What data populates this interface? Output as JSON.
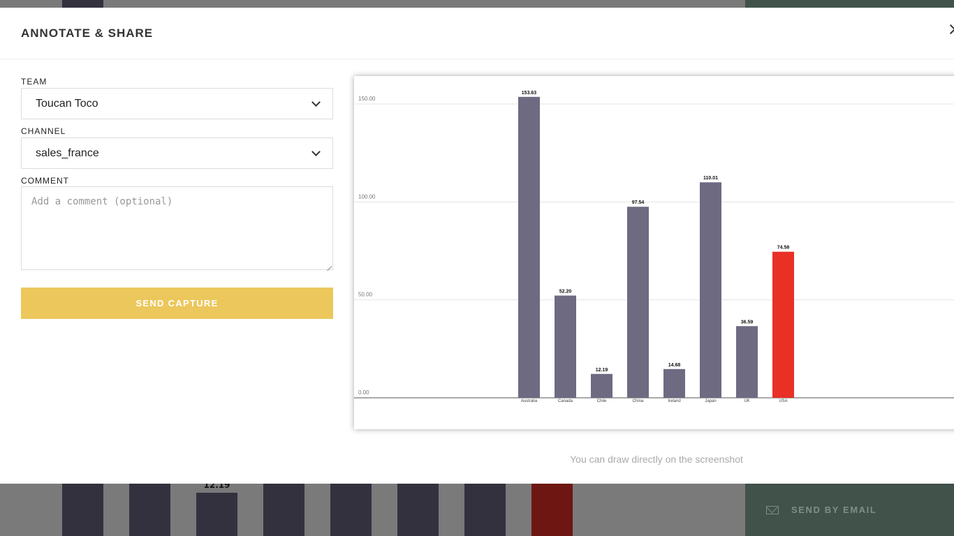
{
  "modal": {
    "title": "ANNOTATE & SHARE",
    "team": {
      "label": "TEAM",
      "value": "Toucan Toco"
    },
    "channel": {
      "label": "CHANNEL",
      "value": "sales_france"
    },
    "comment": {
      "label": "COMMENT",
      "placeholder": "Add a comment (optional)"
    },
    "send_button": "SEND CAPTURE",
    "hint": "You can draw directly on the screenshot"
  },
  "background": {
    "bar_value_label": "12.19",
    "send_email_label": "SEND BY EMAIL"
  },
  "colors": {
    "bar": "#6e6a82",
    "highlight_bar": "#e83025",
    "send_button": "#ecc75c",
    "email_panel": "#41524a"
  },
  "chart_data": {
    "type": "bar",
    "categories": [
      "Australia",
      "Canada",
      "Chile",
      "China",
      "Ireland",
      "Japan",
      "UK",
      "USA"
    ],
    "values": [
      153.63,
      52.2,
      12.19,
      97.54,
      14.68,
      110.01,
      36.59,
      74.58
    ],
    "value_labels": [
      "153.63",
      "52.20",
      "12.19",
      "97.54",
      "14.68",
      "110.01",
      "36.59",
      "74.58"
    ],
    "highlighted": "USA",
    "yticks": [
      "0.00",
      "50.00",
      "100.00",
      "150.00"
    ],
    "ylim": [
      0,
      150
    ],
    "grid": true
  }
}
